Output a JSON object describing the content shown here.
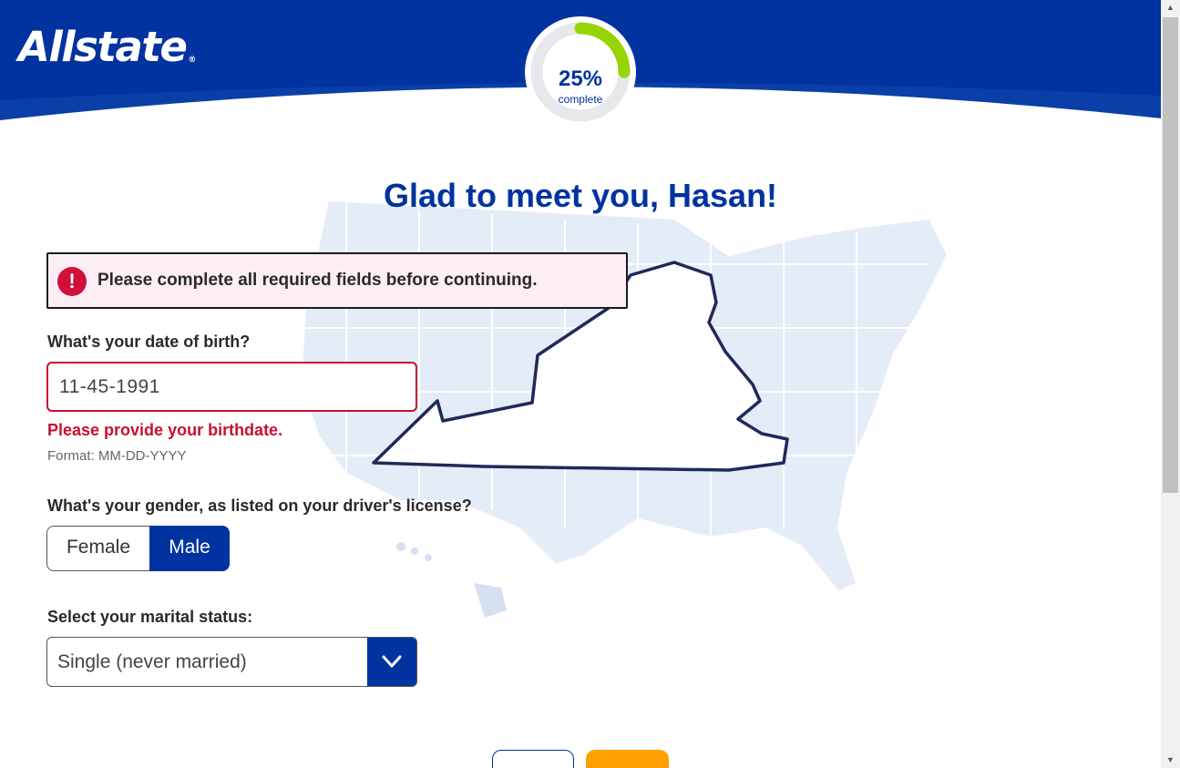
{
  "brand": {
    "logo_text": "Allstate",
    "registered_mark": "®",
    "primary_color": "#0033a0",
    "accent_color": "#96d406",
    "error_color": "#c8102e",
    "next_color": "#ffa000"
  },
  "progress": {
    "percent_label": "25%",
    "sub_label": "complete",
    "fraction": 0.25
  },
  "page": {
    "title": "Glad to meet you, Hasan!"
  },
  "alert": {
    "icon": "exclamation-icon",
    "glyph": "!",
    "message": "Please complete all required fields before continuing."
  },
  "dob": {
    "label": "What's your date of birth?",
    "value": "11-45-1991",
    "error": "Please provide your birthdate.",
    "hint": "Format: MM-DD-YYYY"
  },
  "gender": {
    "label": "What's your gender, as listed on your driver's license?",
    "options": [
      "Female",
      "Male"
    ],
    "selected": "Male"
  },
  "marital": {
    "label": "Select your marital status:",
    "selected": "Single (never married)"
  },
  "scrollbar": {
    "up_glyph": "▲",
    "down_glyph": "▼"
  }
}
